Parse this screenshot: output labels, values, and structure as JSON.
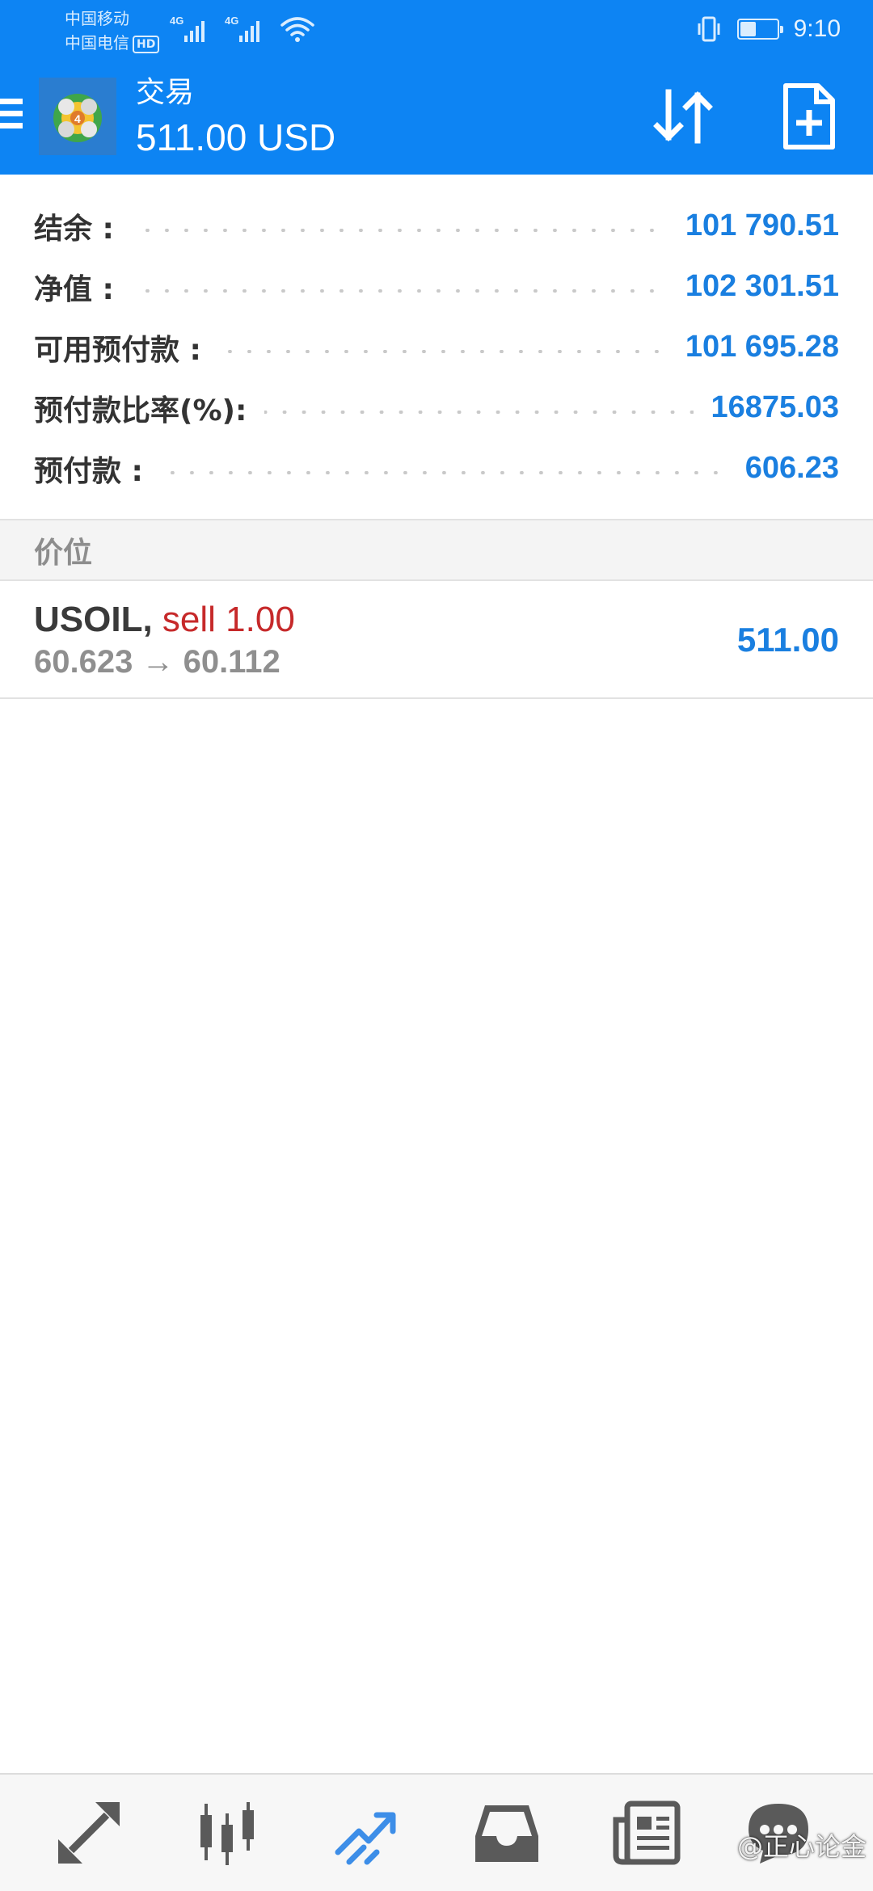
{
  "status_bar": {
    "carrier1": "中国移动",
    "carrier2": "中国电信",
    "hd_badge": "HD",
    "network1": "4G",
    "network2": "4G",
    "time": "9:10",
    "battery_level": 0.4
  },
  "app_bar": {
    "title": "交易",
    "subtitle": "511.00 USD",
    "icons": [
      "menu-icon",
      "metatrader-logo-icon",
      "sort-icon",
      "new-order-icon"
    ]
  },
  "account": {
    "rows": [
      {
        "label": "结余 :",
        "value": "101 790.51"
      },
      {
        "label": "净值 :",
        "value": "102 301.51"
      },
      {
        "label": "可用预付款 :",
        "value": "101 695.28"
      },
      {
        "label": "预付款比率(%):",
        "value": "16875.03"
      },
      {
        "label": "预付款 :",
        "value": "606.23"
      }
    ]
  },
  "positions": {
    "header": "价位",
    "items": [
      {
        "symbol": "USOIL,",
        "side": "sell 1.00",
        "price_move": "60.623 → 60.112",
        "profit": "511.00"
      }
    ]
  },
  "bottom_nav": {
    "items": [
      "quotes-icon",
      "chart-icon",
      "trade-icon",
      "history-icon",
      "news-icon",
      "chat-icon"
    ],
    "active": "trade-icon"
  },
  "watermark": "@正心论金",
  "colors": {
    "primary": "#0d84f3",
    "value_blue": "#1a7fe0",
    "sell_red": "#c6292a",
    "label_dark": "#333333"
  }
}
